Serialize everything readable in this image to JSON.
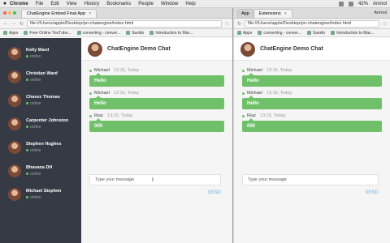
{
  "menubar": {
    "apple": "",
    "items": [
      "Chrome",
      "File",
      "Edit",
      "View",
      "History",
      "Bookmarks",
      "People",
      "Window",
      "Help"
    ],
    "battery": "42%",
    "user": "Anmol"
  },
  "left_window": {
    "tab_title": "ChatEngine Embed Final App",
    "tab_close": "×",
    "url": "file:///Users/apple/Desktop/pn-chatengine/index.html",
    "bookmarks": [
      "Apps",
      "Free Online YouTube...",
      "converting - conver...",
      "Savido",
      "Introduction to Mac..."
    ],
    "users": [
      {
        "name": "Kelly Ward",
        "status": "online"
      },
      {
        "name": "Christian Ward",
        "status": "online"
      },
      {
        "name": "Chavez Thomas",
        "status": "online"
      },
      {
        "name": "Carpenter Johnston",
        "status": "online"
      },
      {
        "name": "Stephen Hughes",
        "status": "online"
      },
      {
        "name": "Bhavana DH",
        "status": "online"
      },
      {
        "name": "Michael Stephen",
        "status": "online"
      }
    ],
    "chat": {
      "title": "ChatEngine Demo Chat",
      "messages": [
        {
          "sender": "Michael",
          "time": "13:15, Today",
          "text": "Hello"
        },
        {
          "sender": "Michael",
          "time": "13:15, Today",
          "text": "Hello"
        },
        {
          "sender": "Riaz",
          "time": "13:15, Today",
          "text": "000"
        }
      ],
      "input_placeholder": "Type your message",
      "send_label": "SEND"
    }
  },
  "right_window": {
    "tab_inactive": "App",
    "tab_title": "Extensions",
    "tab_close": "×",
    "user": "Anmol",
    "url": "file:///Users/apple/Desktop/pn-chatengine/index.html",
    "bookmarks": [
      "Apps",
      "converting - conver...",
      "Savido",
      "Introduction to Mac..."
    ],
    "chat": {
      "title": "ChatEngine Demo Chat",
      "messages": [
        {
          "sender": "Michael",
          "time": "13:15, Today",
          "text": "Hello"
        },
        {
          "sender": "Michael",
          "time": "13:15, Today",
          "text": "Hello"
        },
        {
          "sender": "Riaz",
          "time": "13:15, Today",
          "text": "000"
        }
      ],
      "input_placeholder": "Type your message",
      "send_label": "SEND"
    }
  },
  "colors": {
    "sidebar_bg": "#363a45",
    "bubble": "#70c06a",
    "online_dot": "#6fc16b",
    "send": "#9fc9e8"
  }
}
